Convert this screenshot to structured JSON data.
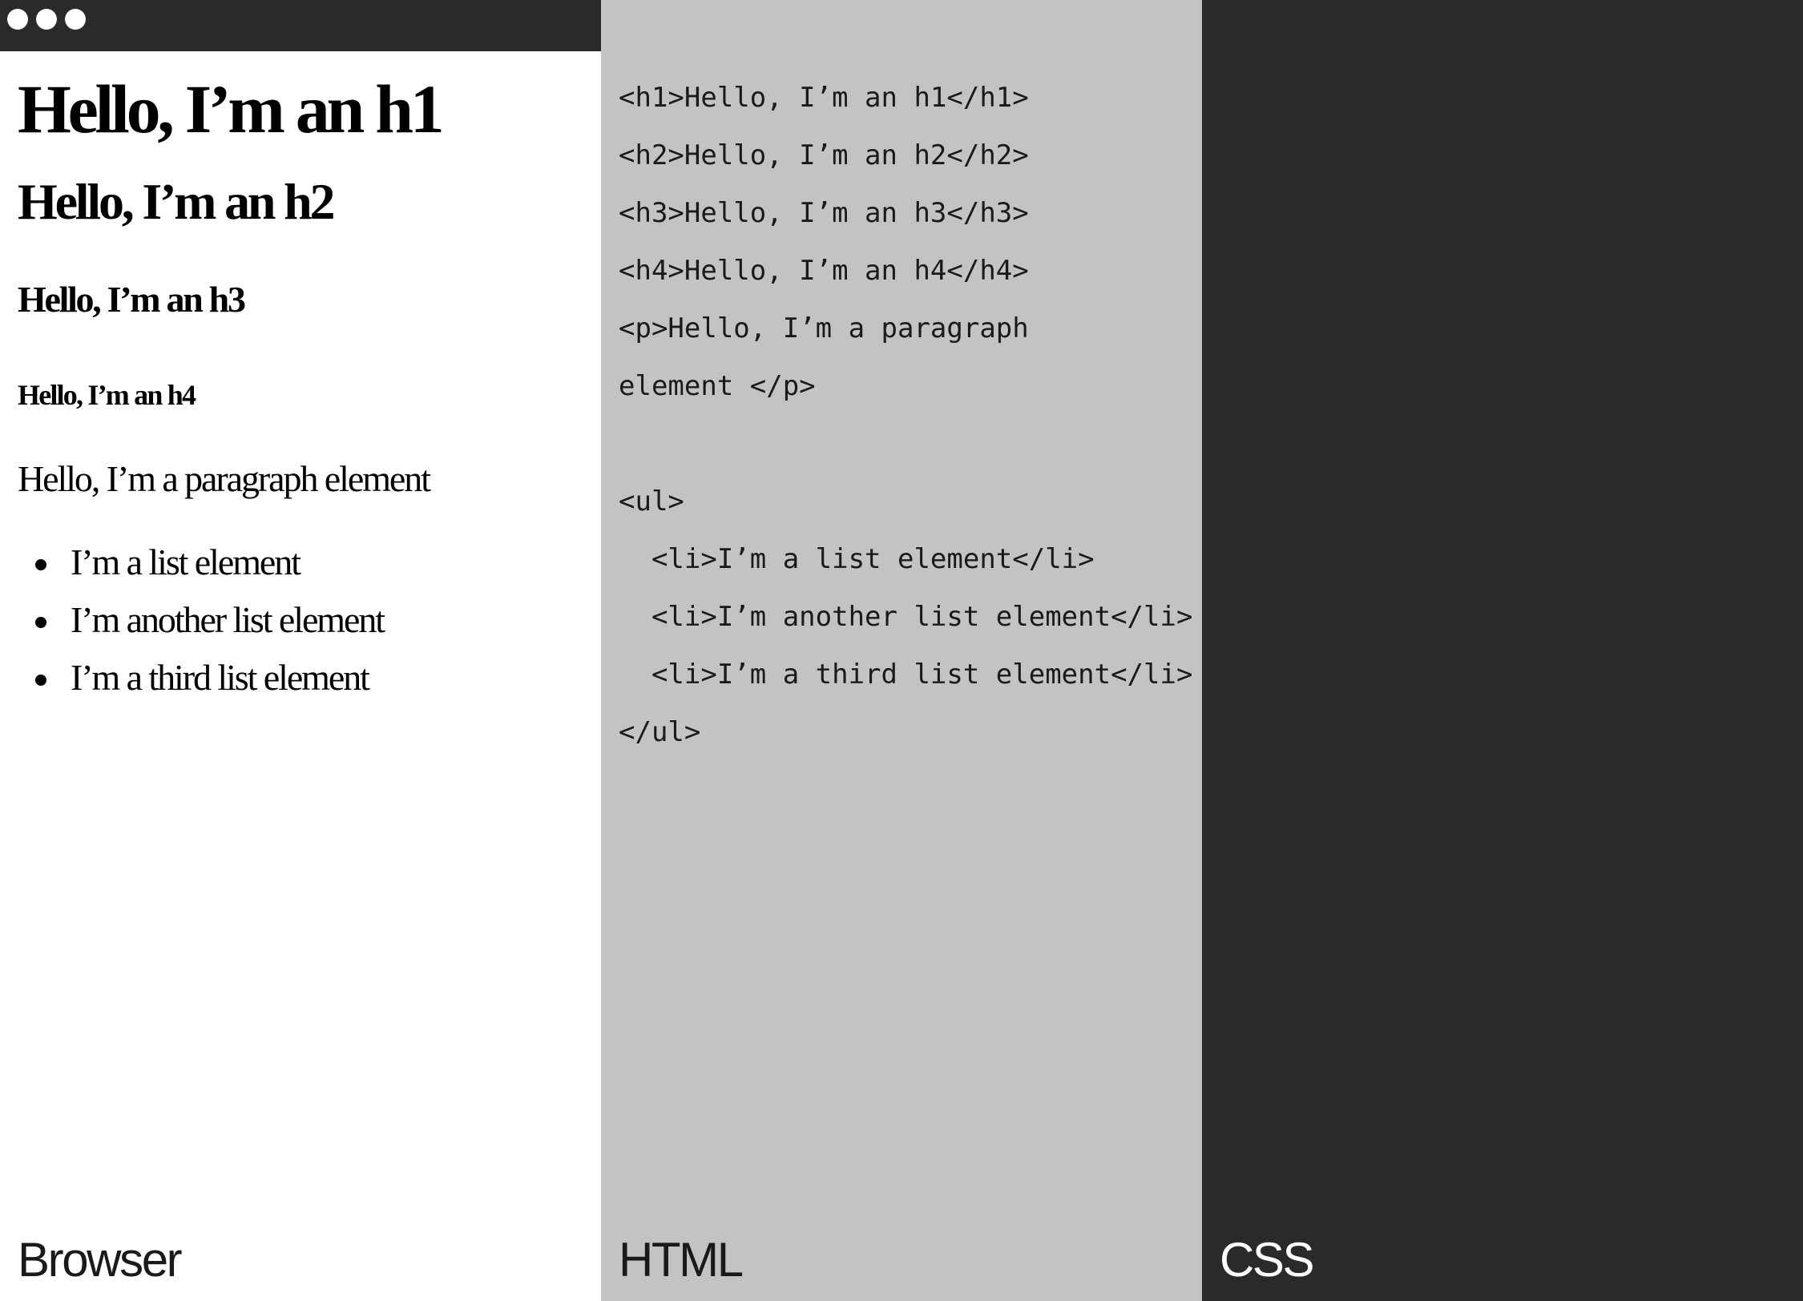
{
  "browser": {
    "rendered": {
      "h1": "Hello, I’m an h1",
      "h2": "Hello, I’m an h2",
      "h3": "Hello, I’m an h3",
      "h4": "Hello, I’m an h4",
      "paragraph": "Hello, I’m a paragraph element",
      "list_items": [
        "I’m a list element",
        "I’m another list element",
        "I’m a third list element"
      ]
    },
    "label": "Browser"
  },
  "html": {
    "code_lines": [
      "<h1>Hello, I’m an h1</h1>",
      "<h2>Hello, I’m an h2</h2>",
      "<h3>Hello, I’m an h3</h3>",
      "<h4>Hello, I’m an h4</h4>",
      "<p>Hello, I’m a paragraph",
      "element </p>",
      "",
      "<ul>",
      "  <li>I’m a list element</li>",
      "  <li>I’m another list element</li>",
      "  <li>I’m a third list element</li>",
      "</ul>"
    ],
    "label": "HTML"
  },
  "css": {
    "label": "CSS"
  },
  "colors": {
    "browser_bg": "#ffffff",
    "html_bg": "#c3c3c3",
    "css_bg": "#2a2a2a",
    "titlebar": "#2a2a2a"
  },
  "icons": {
    "window_controls": [
      "window-dot-icon",
      "window-dot-icon",
      "window-dot-icon"
    ]
  }
}
